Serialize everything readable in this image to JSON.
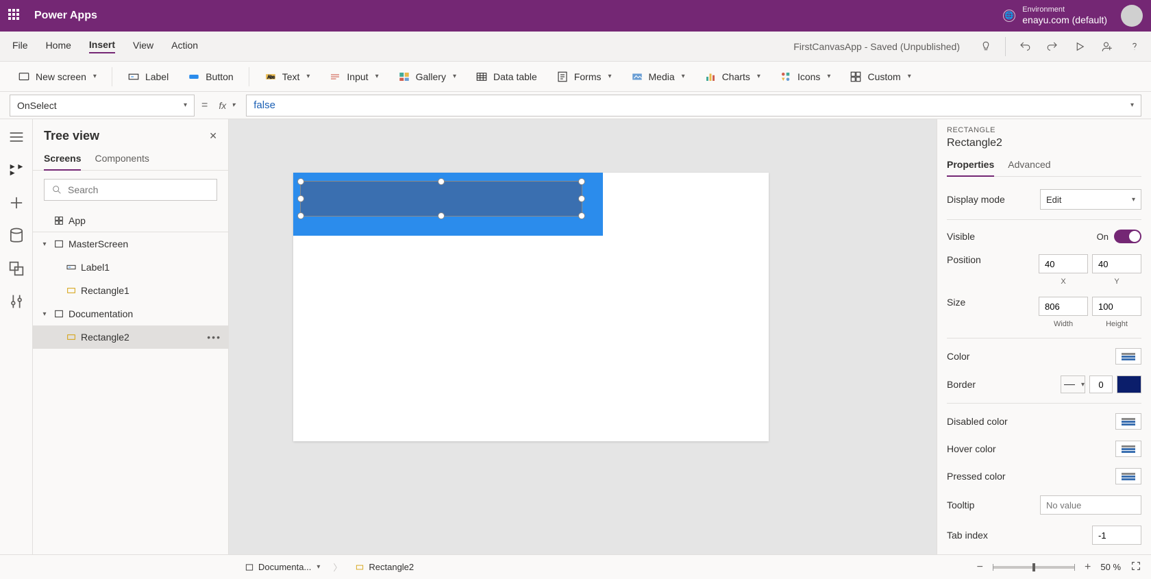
{
  "header": {
    "app_title": "Power Apps",
    "env_label": "Environment",
    "env_name": "enayu.com (default)"
  },
  "menubar": {
    "items": [
      "File",
      "Home",
      "Insert",
      "View",
      "Action"
    ],
    "active_index": 2,
    "app_status": "FirstCanvasApp - Saved (Unpublished)"
  },
  "ribbon": {
    "new_screen": "New screen",
    "label": "Label",
    "button": "Button",
    "text": "Text",
    "input": "Input",
    "gallery": "Gallery",
    "data_table": "Data table",
    "forms": "Forms",
    "media": "Media",
    "charts": "Charts",
    "icons": "Icons",
    "custom": "Custom"
  },
  "formula": {
    "property": "OnSelect",
    "fx": "fx",
    "value": "false"
  },
  "tree": {
    "title": "Tree view",
    "tabs": [
      "Screens",
      "Components"
    ],
    "active_tab": 0,
    "search_placeholder": "Search",
    "app_node": "App",
    "screen1": "MasterScreen",
    "screen1_child1": "Label1",
    "screen1_child2": "Rectangle1",
    "screen2": "Documentation",
    "screen2_child1": "Rectangle2"
  },
  "props": {
    "type": "RECTANGLE",
    "name": "Rectangle2",
    "tabs": [
      "Properties",
      "Advanced"
    ],
    "active_tab": 0,
    "display_mode_label": "Display mode",
    "display_mode_value": "Edit",
    "visible_label": "Visible",
    "visible_value": "On",
    "position_label": "Position",
    "pos_x": "40",
    "pos_y": "40",
    "pos_x_sub": "X",
    "pos_y_sub": "Y",
    "size_label": "Size",
    "width": "806",
    "height": "100",
    "width_sub": "Width",
    "height_sub": "Height",
    "color_label": "Color",
    "border_label": "Border",
    "border_width": "0",
    "disabled_color_label": "Disabled color",
    "hover_color_label": "Hover color",
    "pressed_color_label": "Pressed color",
    "tooltip_label": "Tooltip",
    "tooltip_placeholder": "No value",
    "tabindex_label": "Tab index",
    "tabindex_value": "-1"
  },
  "statusbar": {
    "crumb1": "Documenta...",
    "crumb2": "Rectangle2",
    "zoom": "50",
    "zoom_pct": "%"
  }
}
